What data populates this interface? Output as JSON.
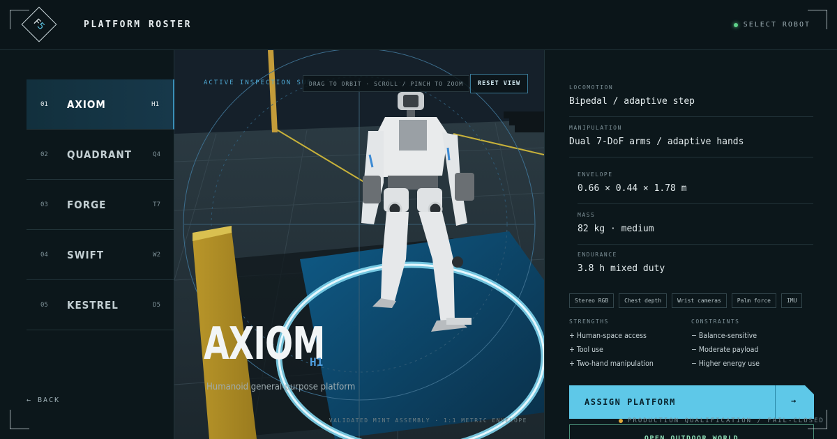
{
  "header": {
    "logo_letter": "F",
    "logo_number": "5",
    "title": "PLATFORM ROSTER",
    "right_label": "SELECT ROBOT"
  },
  "roster": [
    {
      "num": "01",
      "name": "AXIOM",
      "code": "H1",
      "active": true
    },
    {
      "num": "02",
      "name": "QUADRANT",
      "code": "Q4",
      "active": false
    },
    {
      "num": "03",
      "name": "FORGE",
      "code": "T7",
      "active": false
    },
    {
      "num": "04",
      "name": "SWIFT",
      "code": "W2",
      "active": false
    },
    {
      "num": "05",
      "name": "KESTREL",
      "code": "D5",
      "active": false
    }
  ],
  "back_label": "← BACK",
  "viewport": {
    "label": "ACTIVE INSPECTION SUB",
    "hint": "DRAG TO ORBIT · SCROLL / PINCH TO ZOOM",
    "reset": "RESET VIEW",
    "name": "AXIOM",
    "code": "H1",
    "subtitle": "Humanoid general-purpose platform",
    "footer": "VALIDATED MINT ASSEMBLY · 1:1 METRIC ENVELOPE"
  },
  "specs": [
    {
      "key": "LOCOMOTION",
      "value": "Bipedal / adaptive step"
    },
    {
      "key": "MANIPULATION",
      "value": "Dual 7-DoF arms / adaptive hands"
    },
    {
      "key": "ENVELOPE",
      "value": "0.66 × 0.44 × 1.78 m"
    },
    {
      "key": "MASS",
      "value": "82 kg · medium"
    },
    {
      "key": "ENDURANCE",
      "value": "3.8 h mixed duty"
    }
  ],
  "sensors": [
    "Stereo RGB",
    "Chest depth",
    "Wrist cameras",
    "Palm force",
    "IMU"
  ],
  "strengths": {
    "heading": "STRENGTHS",
    "items": [
      "+ Human-space access",
      "+ Tool use",
      "+ Two-hand manipulation"
    ]
  },
  "constraints": {
    "heading": "CONSTRAINTS",
    "items": [
      "− Balance-sensitive",
      "− Moderate payload",
      "− Higher energy use"
    ]
  },
  "assign": {
    "label": "ASSIGN PLATFORM",
    "arrow": "→"
  },
  "production_label": "PRODUCTION QUALIFICATION / FAIL-CLOSED",
  "outdoor_label": "OPEN OUTDOOR WORLD",
  "colors": {
    "accent": "#5ec8e8",
    "active_bg": "#17384a",
    "status_ok": "#5fd28a",
    "status_warn": "#e0a83a"
  }
}
